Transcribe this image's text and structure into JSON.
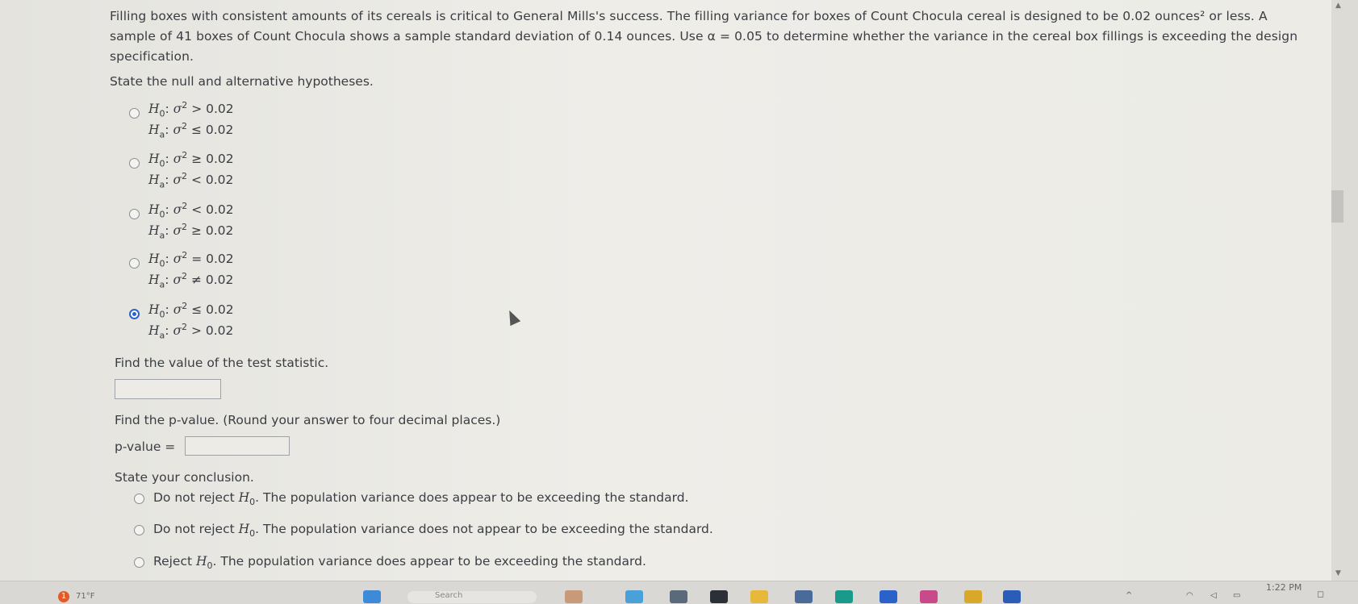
{
  "problem_text": "Filling boxes with consistent amounts of its cereals is critical to General Mills's success. The filling variance for boxes of Count Chocula cereal is designed to be 0.02 ounces² or less. A sample of 41 boxes of Count Chocula shows a sample standard deviation of 0.14 ounces. Use α = 0.05 to determine whether the variance in the cereal box fillings is exceeding the design specification.",
  "hypotheses_prompt": "State the null and alternative hypotheses.",
  "hypothesis_options": [
    {
      "h0_rel": "> 0.02",
      "ha_rel": "≤ 0.02",
      "selected": false
    },
    {
      "h0_rel": "≥ 0.02",
      "ha_rel": "< 0.02",
      "selected": false
    },
    {
      "h0_rel": "< 0.02",
      "ha_rel": "≥ 0.02",
      "selected": false
    },
    {
      "h0_rel": "= 0.02",
      "ha_rel": "≠ 0.02",
      "selected": false
    },
    {
      "h0_rel": "≤ 0.02",
      "ha_rel": "> 0.02",
      "selected": true
    }
  ],
  "test_stat_prompt": "Find the value of the test statistic.",
  "test_stat_value": "",
  "pvalue_prompt": "Find the p-value. (Round your answer to four decimal places.)",
  "pvalue_label": "p-value =",
  "pvalue_value": "",
  "conclusion_prompt": "State your conclusion.",
  "conclusion_options": [
    {
      "pre": "Do not reject ",
      "post": ". The population variance does appear to be exceeding the standard."
    },
    {
      "pre": "Do not reject ",
      "post": ". The population variance does not appear to be exceeding the standard."
    },
    {
      "pre": "Reject ",
      "post": ". The population variance does appear to be exceeding the standard."
    }
  ],
  "sym": {
    "H": "H",
    "h0_sub": "0",
    "ha_sub": "a",
    "sigma": "σ",
    "sq": "2",
    "colon": ":"
  },
  "taskbar": {
    "weather": "71°F",
    "notification_count": "1",
    "search_placeholder": "Search",
    "time": "1:22 PM"
  },
  "colors": {
    "radio_selected": "#2b63c9"
  }
}
